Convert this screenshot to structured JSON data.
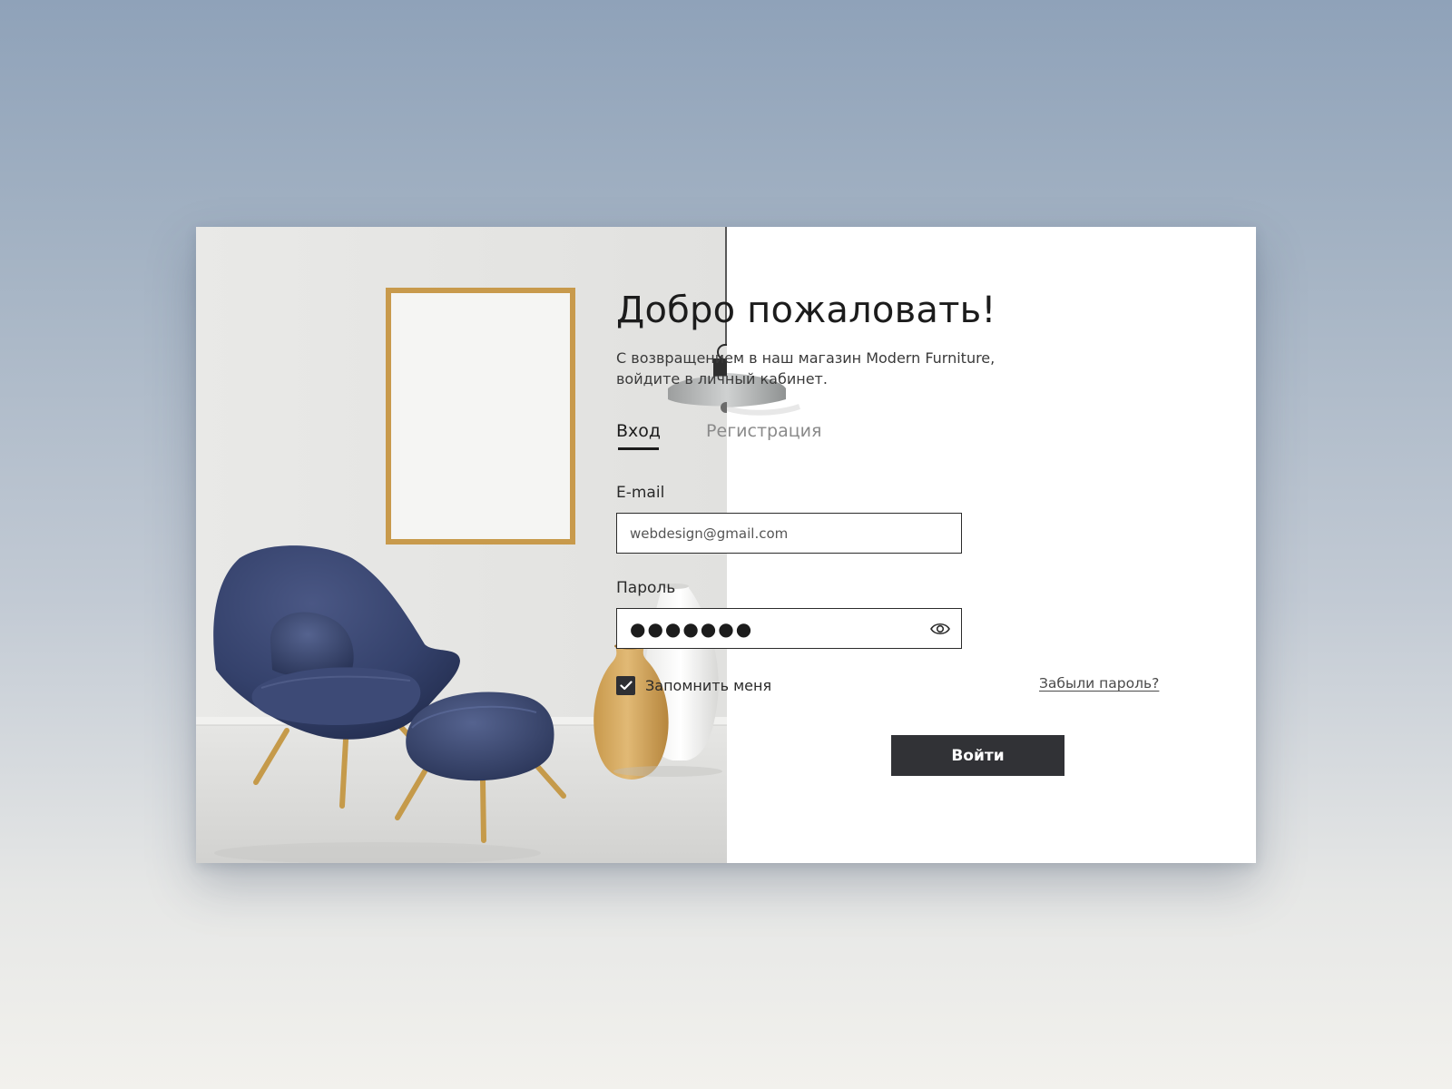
{
  "login": {
    "title": "Добро пожаловать!",
    "subtitle_line1": "С возвращением в наш магазин Modern Furniture,",
    "subtitle_line2": "войдите в личный кабинет.",
    "tabs": [
      {
        "label": "Вход",
        "active": true
      },
      {
        "label": "Регистрация",
        "active": false
      }
    ],
    "email": {
      "label": "E-mail",
      "value": "webdesign@gmail.com"
    },
    "password": {
      "label": "Пароль",
      "masked_value": "●●●●●●●",
      "toggle_icon": "eye-icon"
    },
    "remember": {
      "label": "Запомнить меня",
      "checked": true
    },
    "forgot_link": "Забыли пароль?",
    "submit_label": "Войти"
  },
  "colors": {
    "primary_button": "#313236",
    "text": "#1c1c1c",
    "muted_text": "#8a8a8a",
    "armchair": "#34416b",
    "frame": "#c89a4c"
  }
}
